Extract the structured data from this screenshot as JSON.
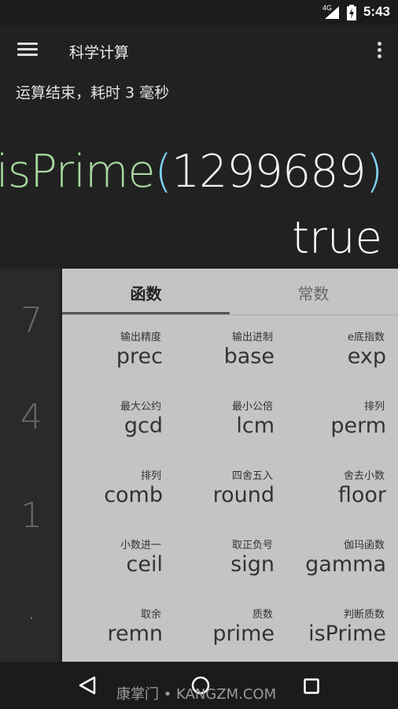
{
  "status_bar": {
    "time": "5:43",
    "network": "4G",
    "icons": [
      "signal-icon",
      "battery-charging-icon"
    ]
  },
  "app_bar": {
    "title": "科学计算",
    "icons": [
      "menu-icon",
      "overflow-menu-icon"
    ]
  },
  "status_message": "运算结束，耗时 3 毫秒",
  "expression": {
    "function": "isPrime",
    "open_paren": "(",
    "argument": "1299689",
    "close_paren": ")"
  },
  "result": "true",
  "keypad": {
    "visible_keys": [
      "7",
      "4",
      "1",
      "."
    ]
  },
  "panel": {
    "tabs": [
      {
        "label": "函数",
        "active": true
      },
      {
        "label": "常数",
        "active": false
      }
    ],
    "functions": [
      {
        "desc": "输出精度",
        "name": "prec"
      },
      {
        "desc": "输出进制",
        "name": "base"
      },
      {
        "desc": "e底指数",
        "name": "exp"
      },
      {
        "desc": "最大公约",
        "name": "gcd"
      },
      {
        "desc": "最小公倍",
        "name": "lcm"
      },
      {
        "desc": "排列",
        "name": "perm"
      },
      {
        "desc": "排列",
        "name": "comb"
      },
      {
        "desc": "四舍五入",
        "name": "round"
      },
      {
        "desc": "舍去小数",
        "name": "floor"
      },
      {
        "desc": "小数进一",
        "name": "ceil"
      },
      {
        "desc": "取正负号",
        "name": "sign"
      },
      {
        "desc": "伽玛函数",
        "name": "gamma"
      },
      {
        "desc": "取余",
        "name": "remn"
      },
      {
        "desc": "质数",
        "name": "prime"
      },
      {
        "desc": "判断质数",
        "name": "isPrime"
      }
    ]
  },
  "nav_bar": {
    "icons": [
      "back-icon",
      "home-icon",
      "recents-icon"
    ]
  },
  "watermark": "康掌门 • KANGZM.COM",
  "colors": {
    "background": "#212121",
    "panel": "#c4c4c4",
    "function_text": "#a8d8a0",
    "paren": "#7fd0f0"
  }
}
